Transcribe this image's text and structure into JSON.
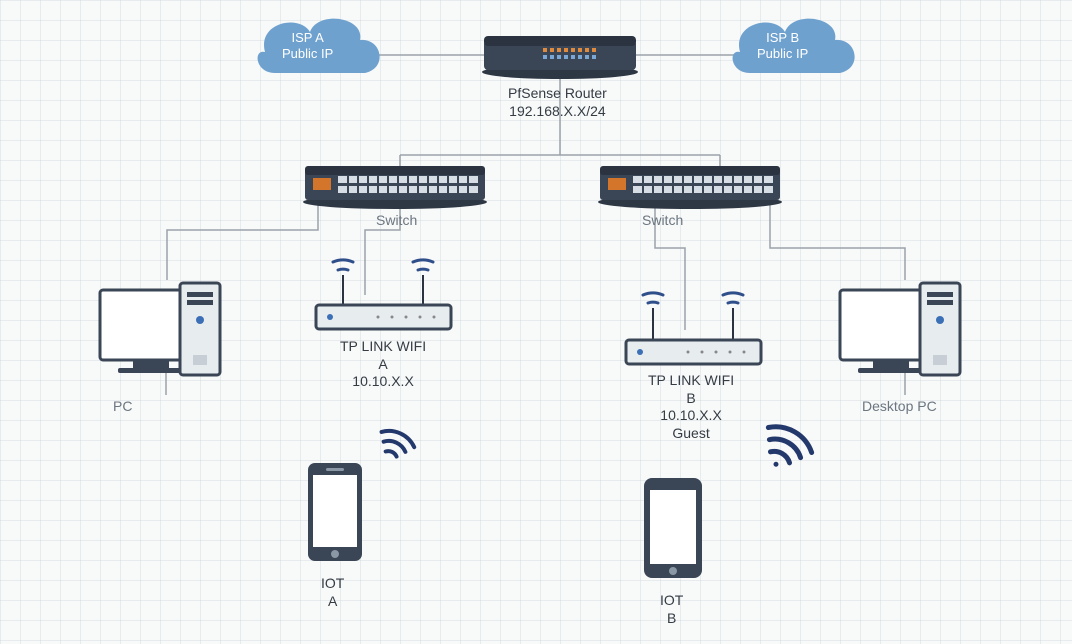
{
  "clouds": {
    "ispA": "ISP A\nPublic IP",
    "ispB": "ISP B\nPublic IP"
  },
  "router": {
    "label": "PfSense Router\n192.168.X.X/24"
  },
  "switches": {
    "left": "Switch",
    "right": "Switch"
  },
  "aps": {
    "a": "TP LINK WIFI\nA\n10.10.X.X",
    "b": "TP LINK WIFI\nB\n10.10.X.X\nGuest"
  },
  "pcs": {
    "left": "PC",
    "right": "Desktop PC"
  },
  "iots": {
    "a": "IOT\nA",
    "b": "IOT\nB"
  },
  "colors": {
    "cloud": "#6fa1cf",
    "cloudText": "#ffffff",
    "device": "#3a4555",
    "deviceLight": "#cfd6de",
    "accentOrange": "#e08a3e",
    "accentBlue": "#3b6fb6",
    "line": "#9aa2a9",
    "wifi": "#2f4f8a"
  }
}
